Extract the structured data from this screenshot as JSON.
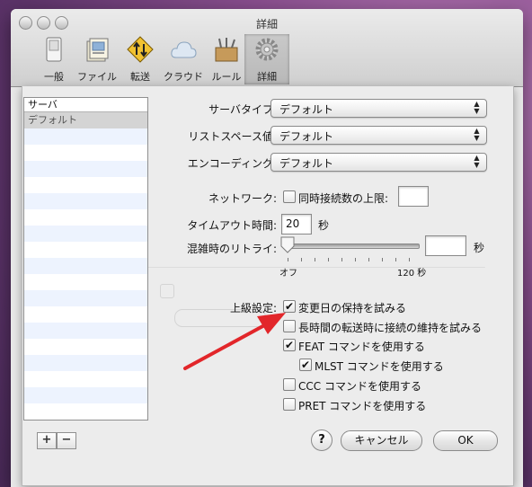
{
  "window": {
    "title": "詳細"
  },
  "toolbar": {
    "items": [
      {
        "label": "一般"
      },
      {
        "label": "ファイル"
      },
      {
        "label": "転送"
      },
      {
        "label": "クラウド"
      },
      {
        "label": "ルール"
      },
      {
        "label": "詳細"
      }
    ]
  },
  "server_list": {
    "header": "サーバ",
    "items": [
      "デフォルト"
    ],
    "add_label": "+",
    "remove_label": "−"
  },
  "settings": {
    "server_type": {
      "label": "サーバタイプ:",
      "value": "デフォルト"
    },
    "list_space": {
      "label": "リストスペース値:",
      "value": "デフォルト"
    },
    "encoding": {
      "label": "エンコーディング:",
      "value": "デフォルト"
    },
    "network": {
      "label": "ネットワーク:",
      "checkbox_label": "同時接続数の上限:",
      "checked": false,
      "value": ""
    },
    "timeout": {
      "label": "タイムアウト時間:",
      "value": "20",
      "unit": "秒"
    },
    "retry": {
      "label": "混雑時のリトライ:",
      "min_label": "オフ",
      "max_label": "120 秒",
      "value": "",
      "unit": "秒",
      "level": 0
    },
    "advanced": {
      "label": "上級設定:",
      "options": [
        {
          "label": "変更日の保持を試みる",
          "checked": true
        },
        {
          "label": "長時間の転送時に接続の維持を試みる",
          "checked": false
        },
        {
          "label": "FEAT コマンドを使用する",
          "checked": true
        },
        {
          "label": "MLST コマンドを使用する",
          "checked": true
        },
        {
          "label": "CCC コマンドを使用する",
          "checked": false
        },
        {
          "label": "PRET コマンドを使用する",
          "checked": false
        }
      ]
    }
  },
  "buttons": {
    "help": "?",
    "cancel": "キャンセル",
    "ok": "OK"
  },
  "check_glyph": "✔",
  "colors": {
    "annotation_arrow": "#e2262a",
    "selected_row": "#d4d4d4",
    "alt_row": "#edf3fe"
  }
}
